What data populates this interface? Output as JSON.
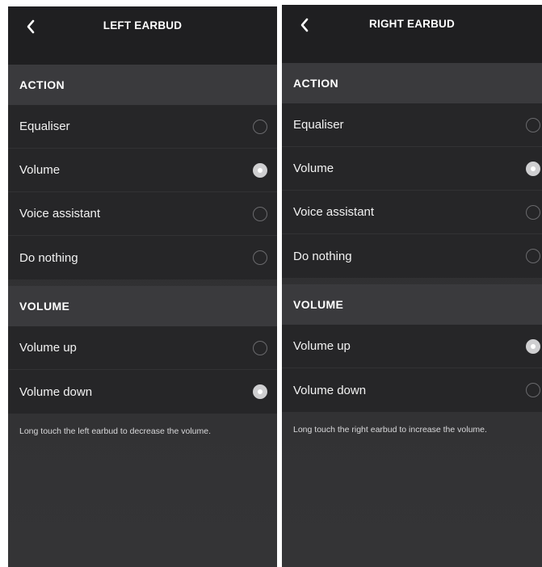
{
  "left": {
    "title": "LEFT EARBUD",
    "action_header": "ACTION",
    "actions": [
      {
        "label": "Equaliser",
        "selected": false
      },
      {
        "label": "Volume",
        "selected": true
      },
      {
        "label": "Voice assistant",
        "selected": false
      },
      {
        "label": "Do nothing",
        "selected": false
      }
    ],
    "volume_header": "VOLUME",
    "volume_options": [
      {
        "label": "Volume up",
        "selected": false
      },
      {
        "label": "Volume down",
        "selected": true
      }
    ],
    "hint": "Long touch the left earbud to decrease the volume."
  },
  "right": {
    "title": "RIGHT EARBUD",
    "action_header": "ACTION",
    "actions": [
      {
        "label": "Equaliser",
        "selected": false
      },
      {
        "label": "Volume",
        "selected": true
      },
      {
        "label": "Voice assistant",
        "selected": false
      },
      {
        "label": "Do nothing",
        "selected": false
      }
    ],
    "volume_header": "VOLUME",
    "volume_options": [
      {
        "label": "Volume up",
        "selected": true
      },
      {
        "label": "Volume down",
        "selected": false
      }
    ],
    "hint": "Long touch the right earbud to increase the volume."
  },
  "icons": {
    "back": "chevron-left-icon",
    "radio_on": "radio-selected-icon",
    "radio_off": "radio-unselected-icon"
  },
  "colors": {
    "header_bg": "#1f1f21",
    "section_bg": "#3a3a3d",
    "row_bg": "#262628",
    "radio_selected": "#cfcfd1"
  }
}
